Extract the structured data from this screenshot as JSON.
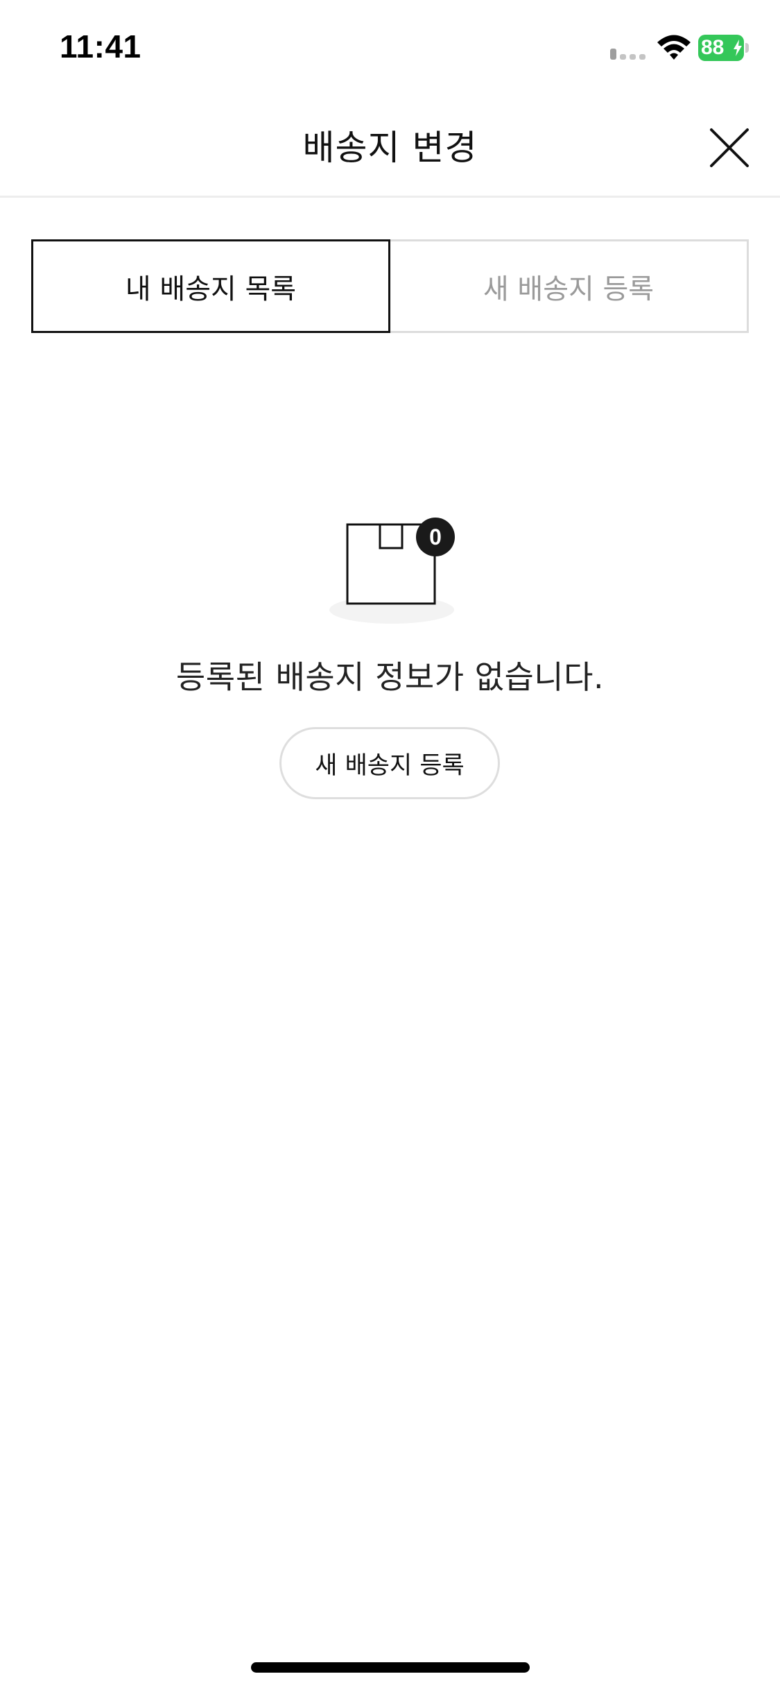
{
  "status_bar": {
    "time": "11:41",
    "battery_level": "88",
    "battery_color": "#34c759",
    "icons": [
      "signal-icon",
      "wifi-icon",
      "battery-icon"
    ]
  },
  "header": {
    "title": "배송지 변경",
    "close_icon": "close-icon"
  },
  "tabs": [
    {
      "label": "내 배송지 목록",
      "active": true
    },
    {
      "label": "새 배송지 등록",
      "active": false
    }
  ],
  "empty_state": {
    "illustration_icon": "box-icon",
    "badge_count": "0",
    "message": "등록된 배송지 정보가 없습니다.",
    "button_label": "새 배송지 등록"
  }
}
